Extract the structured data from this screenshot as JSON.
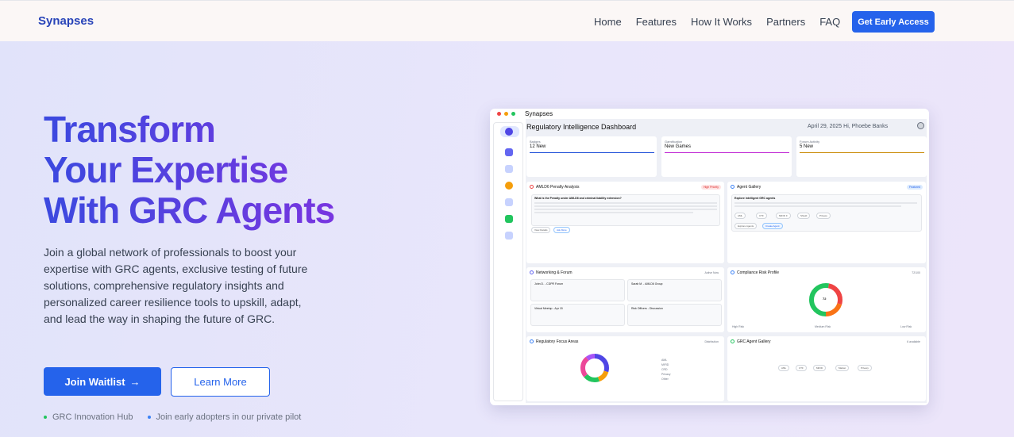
{
  "nav": {
    "brand": "Synapses",
    "links": [
      "Home",
      "Features",
      "How It Works",
      "Partners",
      "FAQ"
    ],
    "cta": "Get Early Access"
  },
  "hero": {
    "title_lines": [
      "Transform",
      "Your Expertise",
      "With GRC Agents"
    ],
    "description": "Join a global network of professionals to boost your expertise with GRC agents, exclusive testing of future solutions, comprehensive regulatory insights and personalized career resilience tools to upskill, adapt, and lead the way in shaping the future of GRC.",
    "primary_button": "Join Waitlist",
    "primary_arrow": "→",
    "secondary_button": "Learn More",
    "bullets": [
      {
        "text": "GRC Innovation Hub",
        "color": "#22c55e"
      },
      {
        "text": "Join early adopters in our private pilot",
        "color": "#3b82f6"
      }
    ]
  },
  "mock": {
    "app_title": "Synapses",
    "dashboard_title": "Regulatory Intelligence Dashboard",
    "date_user": "April 29, 2025   Hi, Phoebe Banks",
    "stats": [
      {
        "label": "Badges",
        "value": "12 New",
        "color": "#1d4ed8"
      },
      {
        "label": "Gamification",
        "value": "New Games",
        "color": "#c026d3"
      },
      {
        "label": "Forum Activity",
        "value": "5 New",
        "color": "#ca8a04"
      }
    ],
    "cards": {
      "aml": {
        "title": "AMLD6 Penalty Analysis",
        "tag": "High Priority",
        "question": "What is the Penalty under AMLD6 and criminal liability extension?",
        "buttons": [
          "View Details",
          "Ask More"
        ]
      },
      "gallery": {
        "title": "Agent Gallery",
        "tag": "Featured",
        "heading": "Explore intelligent GRC agents",
        "chips": [
          "AML",
          "CTF",
          "MiFID II",
          "Shield",
          "Privacy"
        ],
        "buttons": [
          "Explore Agents",
          "Create Agent"
        ]
      },
      "network": {
        "title": "Networking & Forum",
        "tag": "Active Now",
        "items": [
          "John D. - CDPR Forum",
          "Sarah M. - AMLD6 Group",
          "Virtual Meetup - Apr 15",
          "Risk Officers - Discussion"
        ]
      },
      "risk": {
        "title": "Compliance Risk Profile",
        "tag": "72/100",
        "score": "72",
        "legend": [
          "High Risk",
          "Medium Risk",
          "Low Risk"
        ]
      },
      "focus": {
        "title": "Regulatory Focus Areas",
        "tag": "Distribution",
        "legend": [
          "AML",
          "MiFID",
          "CRD",
          "Privacy",
          "Other"
        ]
      },
      "agents": {
        "title": "GRC Agent Gallery",
        "tag": "6 available",
        "chips": [
          "AML",
          "CTF",
          "MiFID",
          "Market",
          "Privacy"
        ]
      }
    }
  }
}
